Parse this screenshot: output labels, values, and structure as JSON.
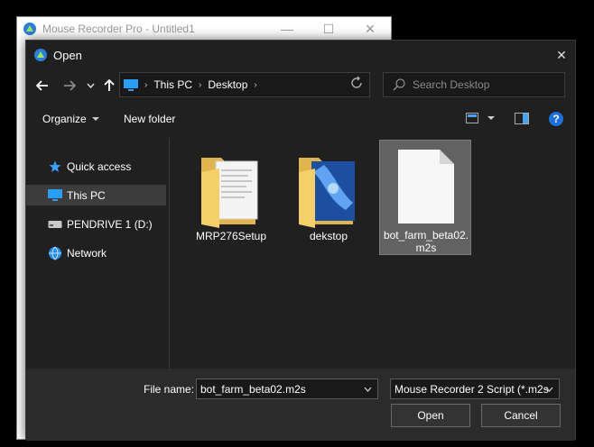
{
  "background_window": {
    "title": "Mouse Recorder Pro - Untitled1",
    "controls": [
      "—",
      "☐",
      "✕"
    ]
  },
  "dialog": {
    "title": "Open",
    "close_glyph": "✕"
  },
  "address_bar": {
    "breadcrumbs": [
      "This PC",
      "Desktop"
    ]
  },
  "search": {
    "placeholder": "Search Desktop"
  },
  "toolbar": {
    "organize_label": "Organize",
    "new_folder_label": "New folder",
    "help_glyph": "?"
  },
  "nav_pane": {
    "items": [
      {
        "label": "Quick access",
        "icon": "star-icon"
      },
      {
        "label": "This PC",
        "icon": "computer-icon",
        "selected": true
      },
      {
        "label": "PENDRIVE 1 (D:)",
        "icon": "drive-icon"
      },
      {
        "label": "Network",
        "icon": "network-icon"
      }
    ]
  },
  "files": [
    {
      "name": "MRP276Setup",
      "type": "folder"
    },
    {
      "name": "dekstop",
      "type": "folder"
    },
    {
      "name": "bot_farm_beta02.m2s",
      "type": "file",
      "selected": true
    }
  ],
  "footer": {
    "file_name_label": "File name:",
    "file_name_value": "bot_farm_beta02.m2s",
    "filter_value": "Mouse Recorder 2 Script (*.m2s",
    "open_label": "Open",
    "cancel_label": "Cancel"
  },
  "colors": {
    "dialog_bg": "#202020",
    "footer_bg": "#2b2b2b",
    "selection": "#626262",
    "accent": "#1e6fd9",
    "folder": "#f4cf6a"
  }
}
